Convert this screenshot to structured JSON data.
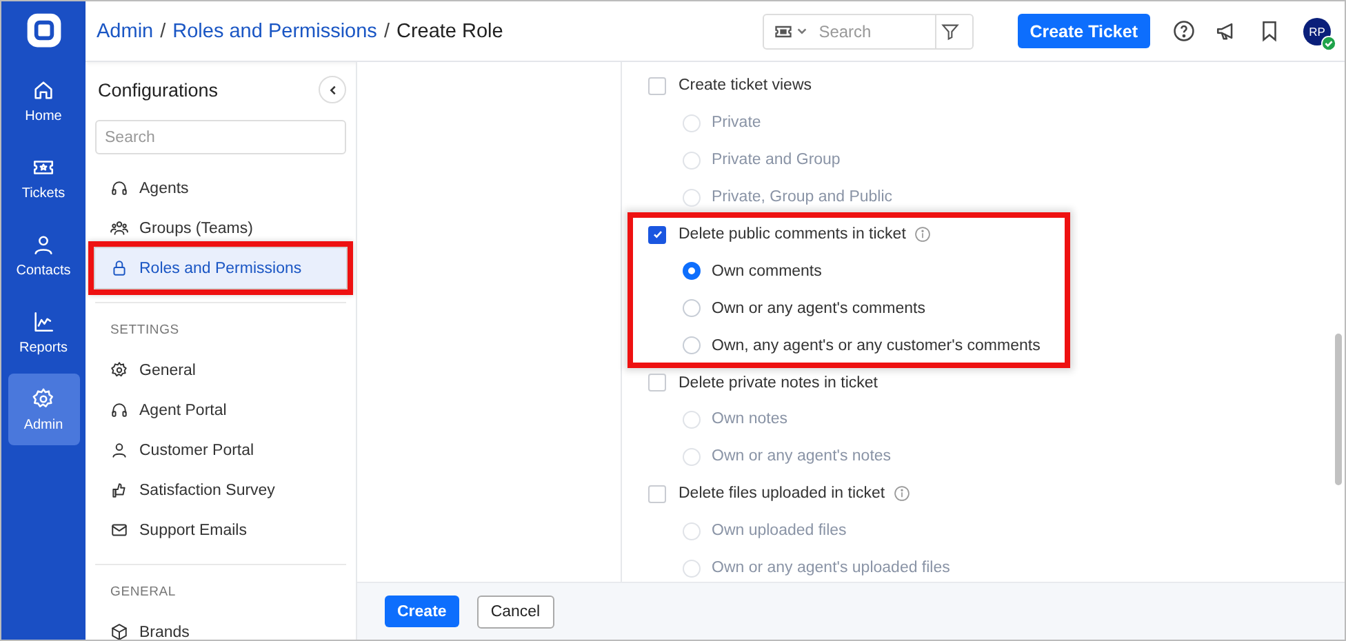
{
  "rail": [
    {
      "label": "Home",
      "kind": "home",
      "selected": false
    },
    {
      "label": "Tickets",
      "kind": "ticket",
      "selected": false
    },
    {
      "label": "Contacts",
      "kind": "person",
      "selected": false
    },
    {
      "label": "Reports",
      "kind": "chart",
      "selected": false
    },
    {
      "label": "Admin",
      "kind": "gear",
      "selected": true
    }
  ],
  "breadcrumb": [
    {
      "label": "Admin",
      "kind": "link"
    },
    {
      "label": "/",
      "kind": "separator"
    },
    {
      "label": "Roles and Permissions",
      "kind": "link"
    },
    {
      "label": "/",
      "kind": "separator"
    },
    {
      "label": "Create Role",
      "kind": "current"
    }
  ],
  "top_search": {
    "placeholder": "Search"
  },
  "create_ticket": "Create Ticket",
  "avatar": {
    "initials": "RP",
    "online": true
  },
  "sidebar": {
    "title": "Configurations",
    "search": {
      "placeholder": "Search"
    },
    "sections": [
      {
        "items": [
          {
            "label": "Agents",
            "kind": "headset",
            "selected": false,
            "highlighted": false
          },
          {
            "label": "Groups (Teams)",
            "kind": "group",
            "selected": false,
            "highlighted": false
          },
          {
            "label": "Roles and Permissions",
            "kind": "lock",
            "selected": true,
            "highlighted": true
          }
        ]
      },
      {
        "heading": "SETTINGS",
        "items": [
          {
            "label": "General",
            "kind": "gear",
            "selected": false,
            "highlighted": false
          },
          {
            "label": "Agent Portal",
            "kind": "headset",
            "selected": false,
            "highlighted": false
          },
          {
            "label": "Customer Portal",
            "kind": "person",
            "selected": false,
            "highlighted": false
          },
          {
            "label": "Satisfaction Survey",
            "kind": "thumb",
            "selected": false,
            "highlighted": false
          },
          {
            "label": "Support Emails",
            "kind": "mail",
            "selected": false,
            "highlighted": false
          }
        ]
      },
      {
        "heading": "GENERAL",
        "items": [
          {
            "label": "Brands",
            "kind": "cube",
            "selected": false,
            "highlighted": false
          }
        ]
      }
    ]
  },
  "permissions": [
    {
      "label": "Create ticket views",
      "checked": false,
      "info": false,
      "highlighted": false,
      "options": [
        {
          "label": "Private",
          "selected": false
        },
        {
          "label": "Private and Group",
          "selected": false
        },
        {
          "label": "Private, Group and Public",
          "selected": false
        }
      ]
    },
    {
      "label": "Delete public comments in ticket",
      "checked": true,
      "info": true,
      "highlighted": true,
      "options": [
        {
          "label": "Own comments",
          "selected": true
        },
        {
          "label": "Own or any agent's comments",
          "selected": false
        },
        {
          "label": "Own, any agent's or any customer's comments",
          "selected": false
        }
      ]
    },
    {
      "label": "Delete private notes in ticket",
      "checked": false,
      "info": false,
      "highlighted": false,
      "options": [
        {
          "label": "Own notes",
          "selected": false
        },
        {
          "label": "Own or any agent's notes",
          "selected": false
        }
      ]
    },
    {
      "label": "Delete files uploaded in ticket",
      "checked": false,
      "info": true,
      "highlighted": false,
      "options": [
        {
          "label": "Own uploaded files",
          "selected": false
        },
        {
          "label": "Own or any agent's uploaded files",
          "selected": false
        }
      ]
    }
  ],
  "footer": {
    "primary": "Create",
    "secondary": "Cancel"
  }
}
